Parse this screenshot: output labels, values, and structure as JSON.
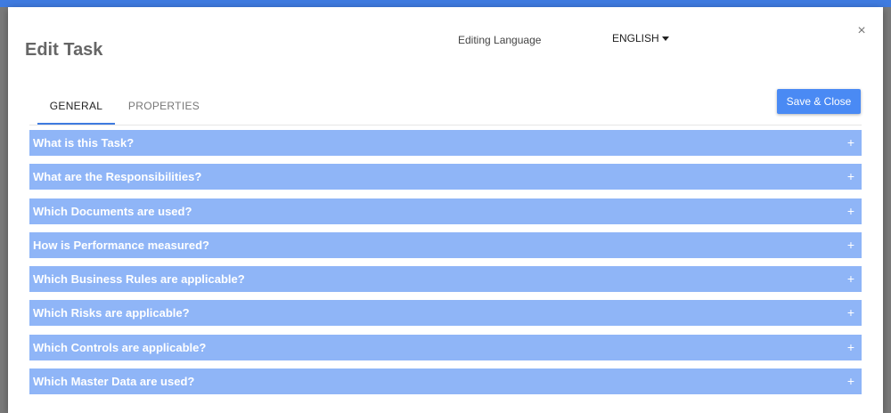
{
  "dialog": {
    "title": "Edit Task",
    "close_glyph": "×"
  },
  "language": {
    "label": "Editing Language",
    "value": "ENGLISH"
  },
  "tabs": [
    {
      "label": "GENERAL",
      "active": true
    },
    {
      "label": "PROPERTIES",
      "active": false
    }
  ],
  "save_button": {
    "label": "Save & Close"
  },
  "accordion": {
    "expand_glyph": "+",
    "items": [
      {
        "label": "What is this Task?"
      },
      {
        "label": "What are the Responsibilities?"
      },
      {
        "label": "Which Documents are used?"
      },
      {
        "label": "How is Performance measured?"
      },
      {
        "label": "Which Business Rules are applicable?"
      },
      {
        "label": "Which Risks are applicable?"
      },
      {
        "label": "Which Controls are applicable?"
      },
      {
        "label": "Which Master Data are used?"
      }
    ]
  },
  "colors": {
    "accent": "#3f7be0",
    "button": "#4a8af4",
    "accordion_header": "#8fb5f7"
  }
}
